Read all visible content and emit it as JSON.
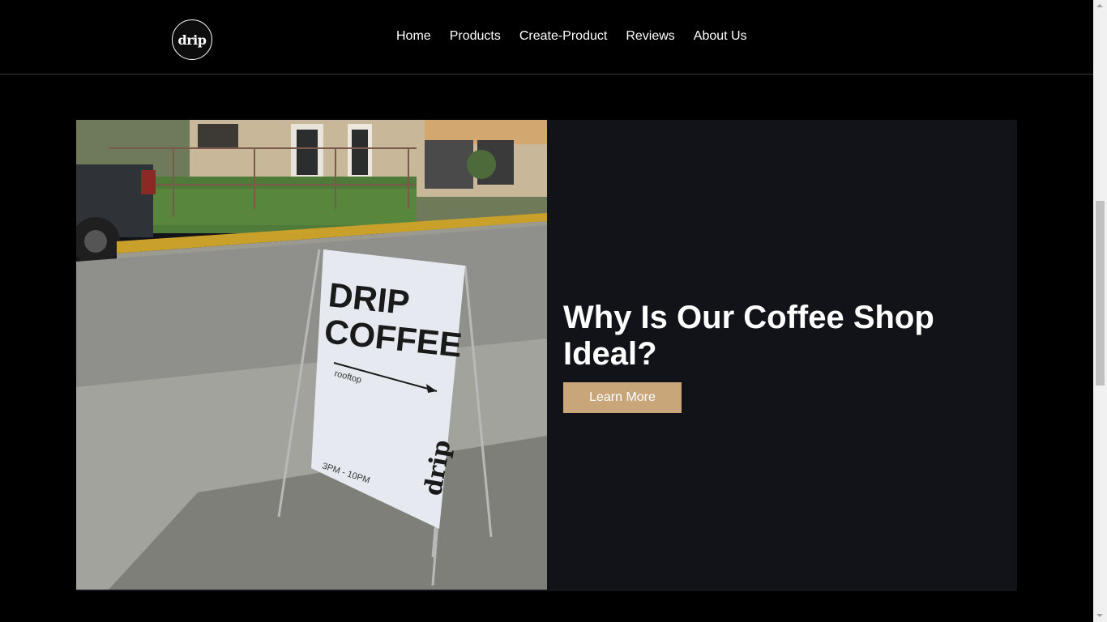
{
  "navbar": {
    "logo_text": "drip",
    "links": [
      {
        "label": "Home"
      },
      {
        "label": "Products"
      },
      {
        "label": "Create-Product"
      },
      {
        "label": "Reviews"
      },
      {
        "label": "About Us"
      }
    ]
  },
  "hero": {
    "title": "Why Is Our Coffee Shop Ideal?",
    "button_label": "Learn More",
    "image": {
      "sign_line1": "DRIP",
      "sign_line2": "COFFEE",
      "sign_sub": "rooftop",
      "sign_hours": "3PM - 10PM",
      "sign_brand": "drip"
    }
  },
  "colors": {
    "page_bg": "#000000",
    "panel_bg": "#121319",
    "accent": "#c9a57a"
  }
}
